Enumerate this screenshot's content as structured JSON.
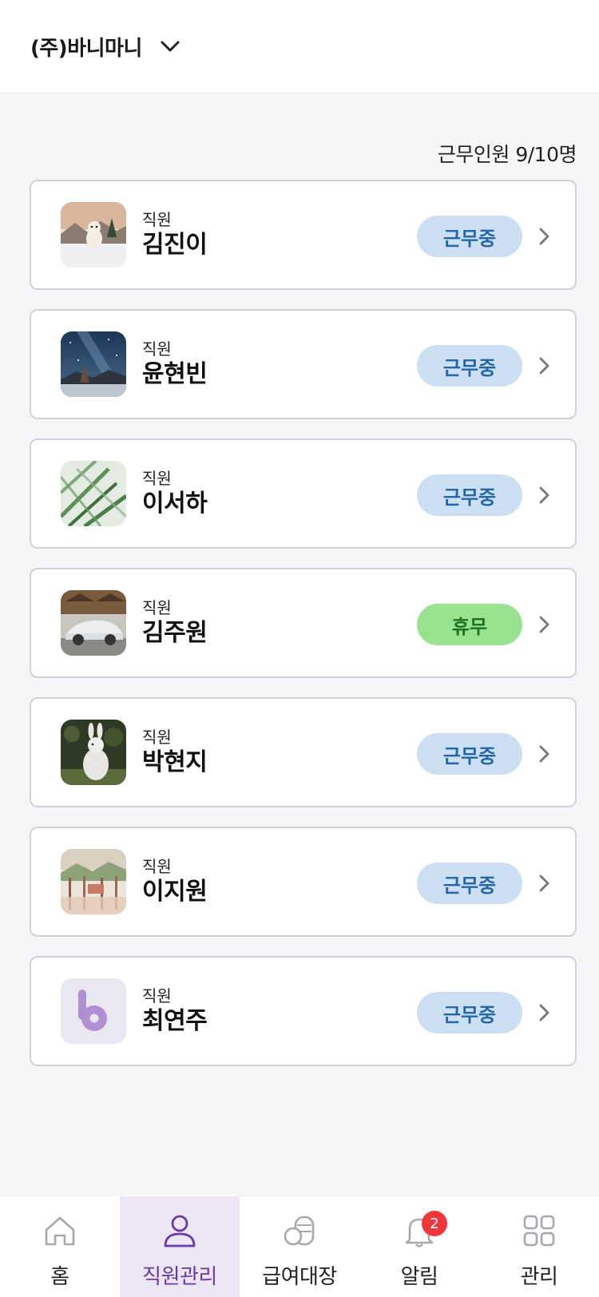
{
  "header": {
    "company": "(주)바니마니",
    "dropdown_icon": "chevron-down-icon"
  },
  "summary": {
    "count_text": "근무인원 9/10명"
  },
  "employees": [
    {
      "role": "직원",
      "name": "김진이",
      "status": "근무중",
      "status_type": "working",
      "avatar": "dog-photo"
    },
    {
      "role": "직원",
      "name": "윤현빈",
      "status": "근무중",
      "status_type": "working",
      "avatar": "night-sky-photo"
    },
    {
      "role": "직원",
      "name": "이서하",
      "status": "근무중",
      "status_type": "working",
      "avatar": "palm-leaves-photo"
    },
    {
      "role": "직원",
      "name": "김주원",
      "status": "휴무",
      "status_type": "off",
      "avatar": "sports-car-photo"
    },
    {
      "role": "직원",
      "name": "박현지",
      "status": "근무중",
      "status_type": "working",
      "avatar": "rabbit-photo"
    },
    {
      "role": "직원",
      "name": "이지원",
      "status": "근무중",
      "status_type": "working",
      "avatar": "painting-photo"
    },
    {
      "role": "직원",
      "name": "최연주",
      "status": "근무중",
      "status_type": "working",
      "avatar": "default-b-logo"
    }
  ],
  "nav": [
    {
      "label": "홈",
      "icon": "home-icon",
      "active": false
    },
    {
      "label": "직원관리",
      "icon": "person-icon",
      "active": true
    },
    {
      "label": "급여대장",
      "icon": "coins-icon",
      "active": false
    },
    {
      "label": "알림",
      "icon": "bell-icon",
      "active": false,
      "badge": "2"
    },
    {
      "label": "관리",
      "icon": "grid-icon",
      "active": false
    }
  ],
  "colors": {
    "accent": "#6a3aa8",
    "working_bg": "#cddff2",
    "working_text": "#2467a8",
    "off_bg": "#99e28f",
    "off_text": "#1f6f1f",
    "notification": "#f0363b"
  }
}
